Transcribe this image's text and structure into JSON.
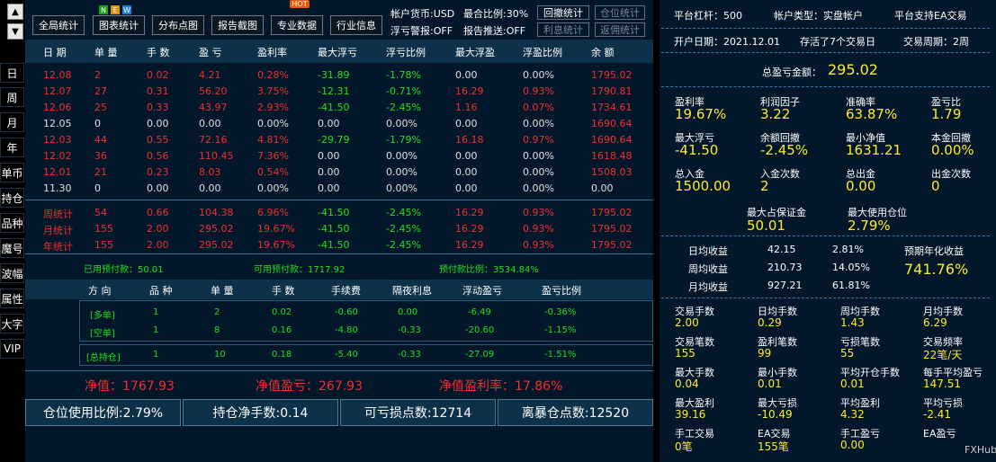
{
  "side": {
    "up": "▲",
    "down": "▼",
    "buttons": [
      "日",
      "周",
      "月",
      "年",
      "单币",
      "持仓",
      "品种",
      "魔号",
      "波幅",
      "属性",
      "大字",
      "VIP"
    ]
  },
  "toolbar": {
    "btns": [
      "全局统计",
      "图表统计",
      "分布点图",
      "报告截图",
      "专业数据",
      "行业信息"
    ],
    "new_badge": [
      "N",
      "E",
      "W"
    ],
    "hot_badge": "HOT",
    "currency": "帐户货币:USD",
    "max_ratio": "最合比例:30%",
    "float_alarm": "浮亏警报:OFF",
    "report_push": "报告推送:OFF",
    "small": [
      "回撤统计",
      "仓位统计",
      "利息统计",
      "返佣统计"
    ]
  },
  "table": {
    "headers": [
      "日 期",
      "单 量",
      "手 数",
      "盈 亏",
      "盈利率",
      "最大浮亏",
      "浮亏比例",
      "最大浮盈",
      "浮盈比例",
      "余 额"
    ],
    "rows": [
      [
        "12.08",
        "2",
        "0.02",
        "4.21",
        "0.28%",
        "-31.89",
        "-1.78%",
        "0.00",
        "0.00%",
        "1795.02"
      ],
      [
        "12.07",
        "27",
        "0.31",
        "56.20",
        "3.75%",
        "-12.31",
        "-0.71%",
        "16.29",
        "0.93%",
        "1790.81"
      ],
      [
        "12.06",
        "25",
        "0.33",
        "43.97",
        "2.93%",
        "-41.50",
        "-2.45%",
        "1.16",
        "0.07%",
        "1734.61"
      ],
      [
        "12.05",
        "0",
        "0.00",
        "0.00",
        "0.00%",
        "0.00",
        "0.00%",
        "0.00",
        "0.00%",
        "1690.64"
      ],
      [
        "12.03",
        "44",
        "0.55",
        "72.16",
        "4.81%",
        "-29.79",
        "-1.79%",
        "16.18",
        "0.97%",
        "1690.64"
      ],
      [
        "12.02",
        "36",
        "0.56",
        "110.45",
        "7.36%",
        "0.00",
        "0.00%",
        "0.00",
        "0.00%",
        "1618.48"
      ],
      [
        "12.01",
        "21",
        "0.23",
        "8.03",
        "0.54%",
        "0.00",
        "0.00%",
        "0.00",
        "0.00%",
        "1508.03"
      ],
      [
        "11.30",
        "0",
        "0.00",
        "0.00",
        "0.00%",
        "0.00",
        "0.00%",
        "0.00",
        "0.00%",
        "0.00"
      ]
    ],
    "stats": [
      [
        "周统计",
        "54",
        "0.66",
        "104.38",
        "6.96%",
        "-41.50",
        "-2.45%",
        "16.29",
        "0.93%",
        "1795.02"
      ],
      [
        "月统计",
        "155",
        "2.00",
        "295.02",
        "19.67%",
        "-41.50",
        "-2.45%",
        "16.29",
        "0.93%",
        "1795.02"
      ],
      [
        "年统计",
        "155",
        "2.00",
        "295.02",
        "19.67%",
        "-41.50",
        "-2.45%",
        "16.29",
        "0.93%",
        "1795.02"
      ]
    ]
  },
  "funds": {
    "used": "已用预付款：50.01",
    "avail": "可用预付款：1717.92",
    "ratio": "预付款比例：3534.84%"
  },
  "pos": {
    "headers": [
      "方 向",
      "品 种",
      "单 量",
      "手 数",
      "手续费",
      "隔夜利息",
      "浮动盈亏",
      "盈亏比例"
    ],
    "long": [
      "[多单]",
      "1",
      "2",
      "0.02",
      "-0.60",
      "0.00",
      "-6.49",
      "-0.36%"
    ],
    "short": [
      "[空单]",
      "1",
      "8",
      "0.16",
      "-4.80",
      "-0.33",
      "-20.60",
      "-1.15%"
    ],
    "total": [
      "[总持仓]",
      "1",
      "10",
      "0.18",
      "-5.40",
      "-0.33",
      "-27.09",
      "-1.51%"
    ]
  },
  "equity": {
    "net": "净值：1767.93",
    "pnl": "净值盈亏：267.93",
    "rate": "净值盈利率：17.86%"
  },
  "bottom": [
    "仓位使用比例:2.79%",
    "持仓净手数:0.14",
    "可亏损点数:12714",
    "离暴仓点数:12520"
  ],
  "right": {
    "lev": "平台杠杆：500",
    "acct": "帐户类型：实盘帐户",
    "ea": "平台支持EA交易",
    "open": "开户日期：2021.12.01",
    "live": "存活了7个交易日",
    "cycle": "交易周期：2周",
    "total_label": "总盈亏金额：",
    "total_val": "295.02",
    "g1": [
      [
        "盈利率",
        "19.67%"
      ],
      [
        "利润因子",
        "3.22"
      ],
      [
        "准确率",
        "63.87%"
      ],
      [
        "盈亏比",
        "1.79"
      ],
      [
        "最大浮亏",
        "-41.50"
      ],
      [
        "余额回撤",
        "-2.45%"
      ],
      [
        "最小净值",
        "1631.21"
      ],
      [
        "本金回撤",
        "0.00%"
      ],
      [
        "总入金",
        "1500.00"
      ],
      [
        "入金次数",
        "2"
      ],
      [
        "总出金",
        "0.00"
      ],
      [
        "出金次数",
        "0"
      ]
    ],
    "margin": [
      [
        "最大占保证金",
        "50.01"
      ],
      [
        "最大使用仓位",
        "2.79%"
      ]
    ],
    "avg": [
      [
        "日均收益",
        "42.15",
        "2.81%"
      ],
      [
        "周均收益",
        "210.73",
        "14.05%"
      ],
      [
        "月均收益",
        "927.21",
        "61.81%"
      ]
    ],
    "annual_label": "预期年化收益",
    "annual_val": "741.76%",
    "g2": [
      [
        "交易手数",
        "2.00"
      ],
      [
        "日均手数",
        "0.29"
      ],
      [
        "周均手数",
        "1.43"
      ],
      [
        "月均手数",
        "6.29"
      ],
      [
        "交易笔数",
        "155"
      ],
      [
        "盈利笔数",
        "99"
      ],
      [
        "亏损笔数",
        "55"
      ],
      [
        "交易频率",
        "22笔/天"
      ],
      [
        "最大手数",
        "0.04"
      ],
      [
        "最小手数",
        "0.01"
      ],
      [
        "平均开仓手数",
        "0.01"
      ],
      [
        "每手平均盈亏",
        "147.51"
      ],
      [
        "最大盈利",
        "39.16"
      ],
      [
        "最大亏损",
        "-10.49"
      ],
      [
        "平均盈利",
        "4.32"
      ],
      [
        "平均亏损",
        "-2.41"
      ],
      [
        "手工交易",
        "0笔"
      ],
      [
        "EA交易",
        "155笔"
      ],
      [
        "手工盈亏",
        "0.00"
      ],
      [
        "EA盈亏",
        ""
      ]
    ]
  },
  "watermark": "FXHub"
}
